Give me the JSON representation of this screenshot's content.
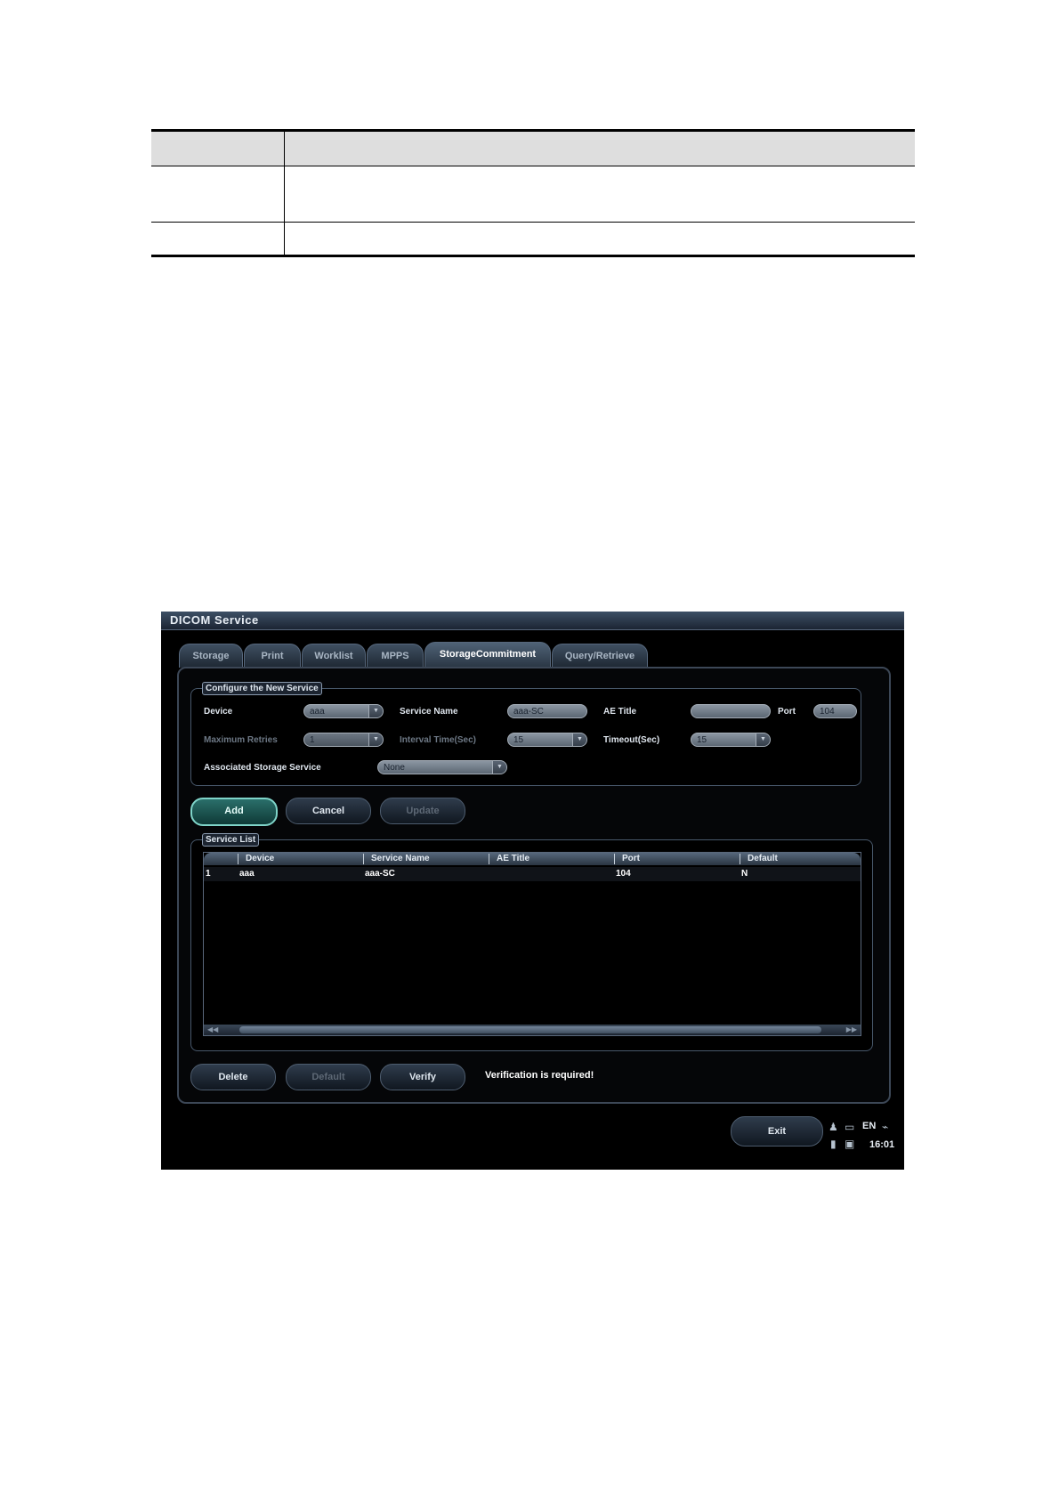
{
  "window": {
    "title": "DICOM Service"
  },
  "tabs": [
    {
      "label": "Storage"
    },
    {
      "label": "Print"
    },
    {
      "label": "Worklist"
    },
    {
      "label": "MPPS"
    },
    {
      "label": "StorageCommitment",
      "active": true
    },
    {
      "label": "Query/Retrieve"
    }
  ],
  "config": {
    "group_label": "Configure the New Service",
    "device": {
      "label": "Device",
      "value": "aaa"
    },
    "service_name": {
      "label": "Service Name",
      "value": "aaa-SC"
    },
    "ae_title": {
      "label": "AE Title",
      "value": ""
    },
    "port": {
      "label": "Port",
      "value": "104"
    },
    "max_retries": {
      "label": "Maximum Retries",
      "value": "1"
    },
    "interval_time": {
      "label": "Interval Time(Sec)",
      "value": "15"
    },
    "timeout": {
      "label": "Timeout(Sec)",
      "value": "15"
    },
    "assoc_storage": {
      "label": "Associated Storage Service",
      "value": "None"
    }
  },
  "actions": {
    "add": "Add",
    "cancel": "Cancel",
    "update": "Update"
  },
  "service_list": {
    "group_label": "Service List",
    "columns": [
      "Device",
      "Service Name",
      "AE Title",
      "Port",
      "Default"
    ],
    "rows": [
      {
        "index": "1",
        "device": "aaa",
        "service_name": "aaa-SC",
        "ae_title": "",
        "port": "104",
        "default": "N"
      }
    ]
  },
  "bottom_actions": {
    "delete": "Delete",
    "default": "Default",
    "verify": "Verify"
  },
  "status": {
    "message": "Verification is required!"
  },
  "footer": {
    "exit": "Exit",
    "language": "EN",
    "time": "16:01"
  },
  "icons": [
    "user-icon",
    "network-icon",
    "usb-icon",
    "trash-icon",
    "monitor-icon"
  ]
}
